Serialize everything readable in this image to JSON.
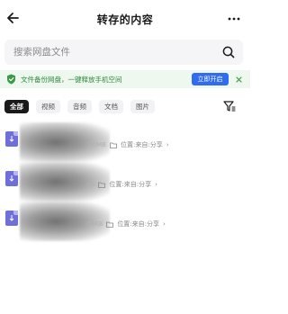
{
  "header": {
    "title": "转存的内容",
    "more_label": "···"
  },
  "search": {
    "placeholder": "搜索网盘文件"
  },
  "banner": {
    "text": "文件备份网盘，一键释放手机空间",
    "button_label": "立即开启",
    "close_label": "×",
    "accent_color": "#2f8a3c",
    "button_color": "#2f6cf0"
  },
  "tabs": [
    {
      "label": "全部",
      "active": true
    },
    {
      "label": "视频",
      "active": false
    },
    {
      "label": "音频",
      "active": false
    },
    {
      "label": "文档",
      "active": false
    },
    {
      "label": "图片",
      "active": false
    }
  ],
  "files": [
    {
      "size": "3.0MB",
      "location": "位置:来自:分享",
      "chevron": "›"
    },
    {
      "size": "KB",
      "location": "位置:来自:分享",
      "chevron": "›"
    },
    {
      "size": "44KB",
      "location": "位置:来自:分享",
      "chevron": "›"
    }
  ],
  "icons": {
    "back": "back-arrow-icon",
    "more": "more-icon",
    "search": "search-icon",
    "banner": "shield-check-icon",
    "filter": "filter-icon",
    "file": "file-icon",
    "folder": "folder-icon"
  }
}
